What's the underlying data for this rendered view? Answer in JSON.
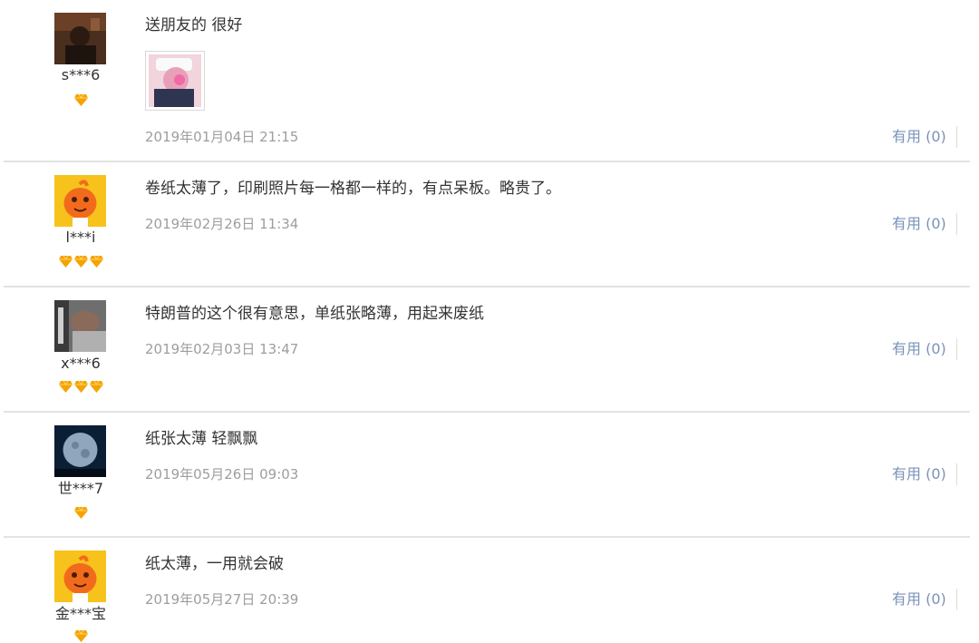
{
  "reviews": [
    {
      "user": "s***6",
      "content": "送朋友的 很好",
      "time": "2019年01月04日 21:15",
      "useful": "有用 (0)",
      "level": 1,
      "avatar_icon": "photo-avatar-dark"
    },
    {
      "user": "l***i",
      "content": "卷纸太薄了，印刷照片每一格都一样的，有点呆板。略贵了。",
      "time": "2019年02月26日 11:34",
      "useful": "有用 (0)",
      "level": 3,
      "avatar_icon": "orange-mascot-avatar"
    },
    {
      "user": "x***6",
      "content": "特朗普的这个很有意思，单纸张略薄，用起来废纸",
      "time": "2019年02月03日 13:47",
      "useful": "有用 (0)",
      "level": 3,
      "avatar_icon": "photo-avatar-gray"
    },
    {
      "user": "世***7",
      "content": "纸张太薄 轻飘飘",
      "time": "2019年05月26日 09:03",
      "useful": "有用 (0)",
      "level": 1,
      "avatar_icon": "moon-avatar"
    },
    {
      "user": "金***宝",
      "content": "纸太薄，一用就会破",
      "time": "2019年05月27日 20:39",
      "useful": "有用 (0)",
      "level": 1,
      "avatar_icon": "orange-mascot-avatar"
    }
  ],
  "colors": {
    "text": "#333333",
    "time": "#9e9e9e",
    "useful_link": "#7a93b8",
    "badge": "#f5a300",
    "divider": "#e3e3e3"
  }
}
